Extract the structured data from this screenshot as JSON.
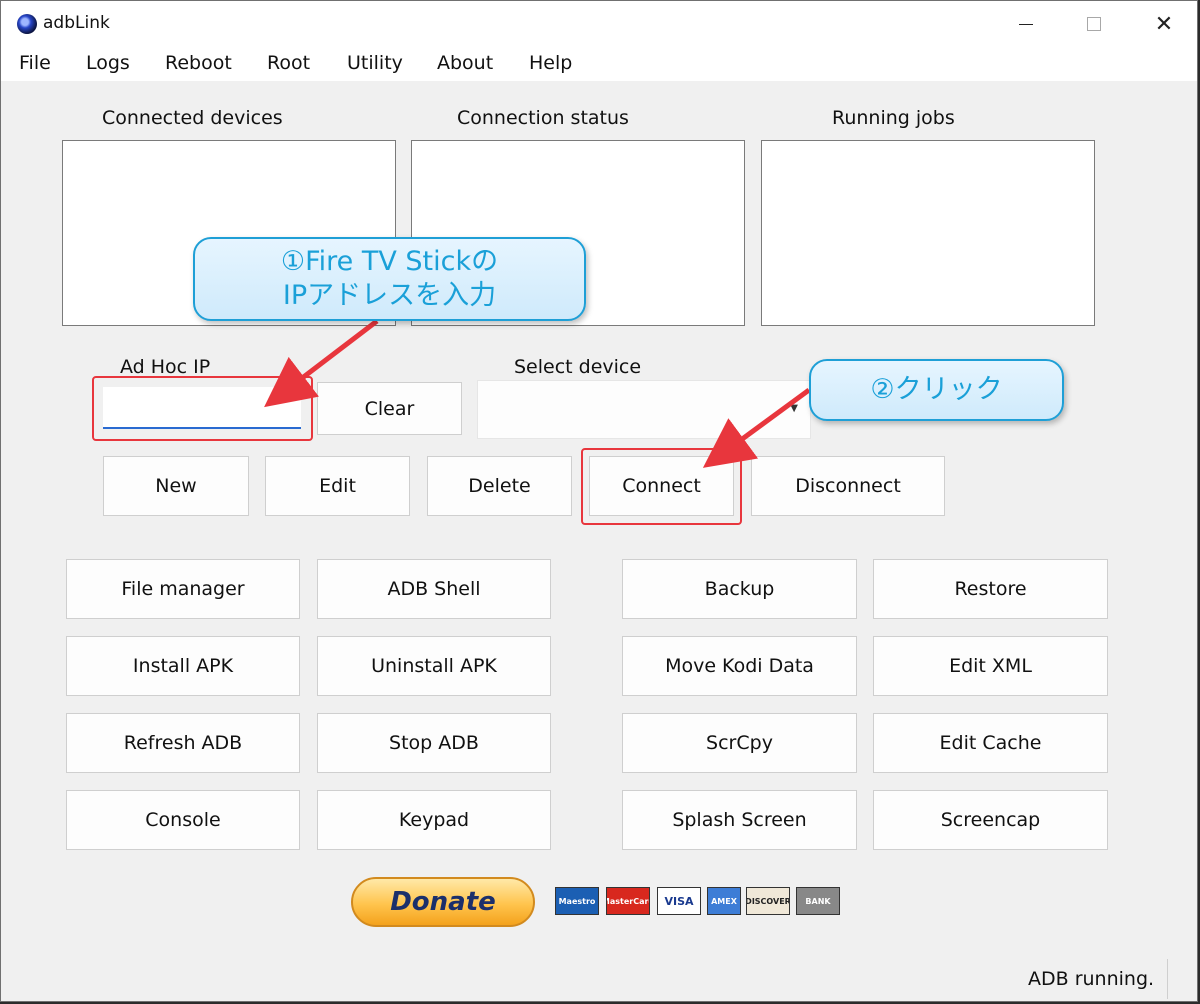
{
  "window": {
    "title": "adbLink"
  },
  "menu": [
    "File",
    "Logs",
    "Reboot",
    "Root",
    "Utility",
    "About",
    "Help"
  ],
  "panels": {
    "connected_devices": "Connected devices",
    "connection_status": "Connection status",
    "running_jobs": "Running jobs"
  },
  "adhoc": {
    "label": "Ad Hoc IP",
    "value": "",
    "clear": "Clear"
  },
  "select_device": {
    "label": "Select device",
    "value": ""
  },
  "device_buttons": [
    "New",
    "Edit",
    "Delete",
    "Connect",
    "Disconnect"
  ],
  "tools": [
    [
      "File manager",
      "ADB Shell",
      "Backup",
      "Restore"
    ],
    [
      "Install APK",
      "Uninstall APK",
      "Move Kodi Data",
      "Edit XML"
    ],
    [
      "Refresh ADB",
      "Stop ADB",
      "ScrCpy",
      "Edit Cache"
    ],
    [
      "Console",
      "Keypad",
      "Splash Screen",
      "Screencap"
    ]
  ],
  "donate": "Donate",
  "cards": [
    "Maestro",
    "MasterCard",
    "VISA",
    "AMEX",
    "DISCOVER",
    "BANK"
  ],
  "status": "ADB running.",
  "annotations": {
    "callout1_line1": "①Fire TV Stickの",
    "callout1_line2": "IPアドレスを入力",
    "callout2": "②クリック"
  },
  "colors": {
    "annotation_red": "#e8363d",
    "callout_blue": "#1e9fd6",
    "input_focus": "#2a6bd1"
  }
}
